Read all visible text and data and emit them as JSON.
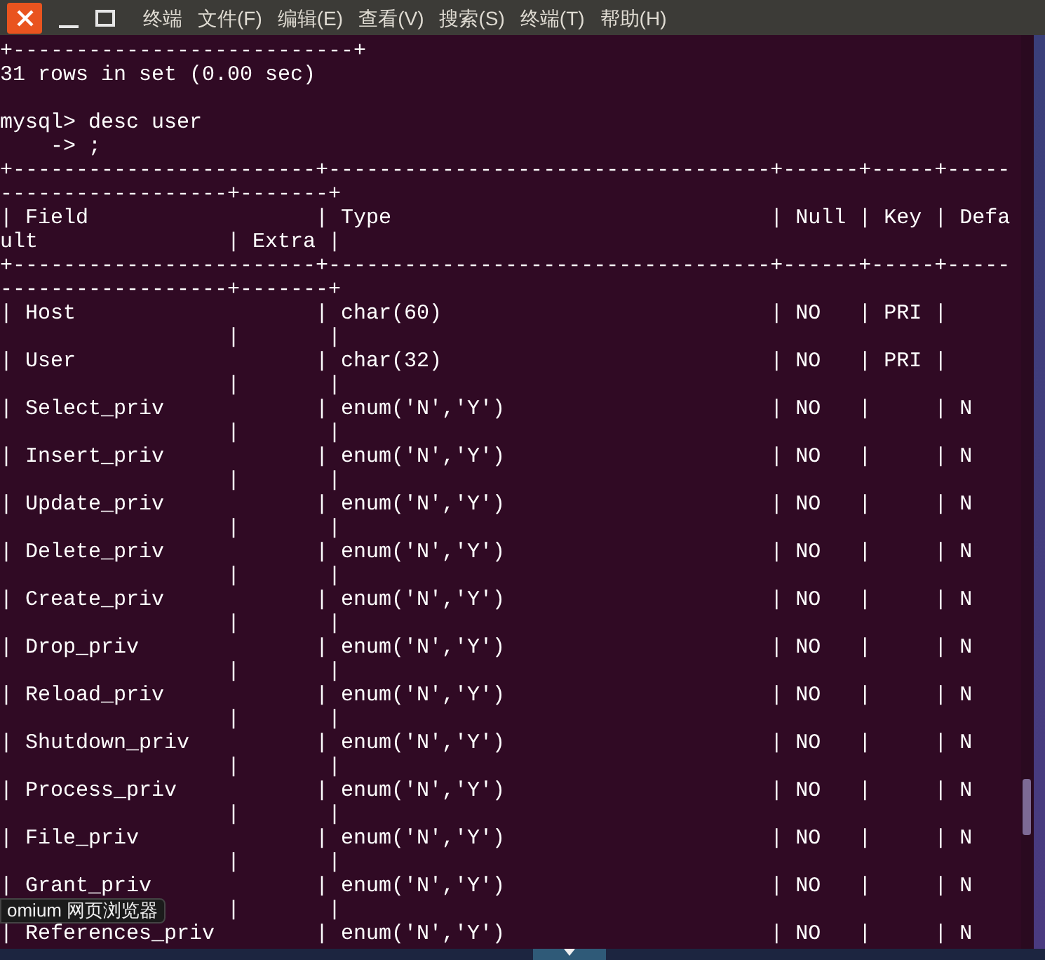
{
  "menu_bar": {
    "items": [
      "终端",
      "文件(F)",
      "编辑(E)",
      "查看(V)",
      "搜索(S)",
      "终端(T)",
      "帮助(H)"
    ]
  },
  "terminal": {
    "lines": [
      {
        "kind": "text",
        "text": "+---------------------------+"
      },
      {
        "kind": "text",
        "text": "31 rows in set (0.00 sec)"
      },
      {
        "kind": "blank"
      },
      {
        "kind": "text",
        "text": "mysql> desc user"
      },
      {
        "kind": "text",
        "text": "    -> ;"
      },
      {
        "kind": "text",
        "text": "+------------------------+-----------------------------------+------+-----+-----"
      },
      {
        "kind": "text",
        "text": "------------------+-------+"
      },
      {
        "kind": "text",
        "text": "| Field                  | Type                              | Null | Key | Defa"
      },
      {
        "kind": "text",
        "text": "ult               | Extra |"
      },
      {
        "kind": "text",
        "text": "+------------------------+-----------------------------------+------+-----+-----"
      },
      {
        "kind": "text",
        "text": "------------------+-------+"
      },
      {
        "kind": "text",
        "text": "| Host                   | char(60)                          | NO   | PRI |"
      },
      {
        "kind": "text",
        "text": "                  |       |"
      },
      {
        "kind": "text",
        "text": "| User                   | char(32)                          | NO   | PRI |"
      },
      {
        "kind": "text",
        "text": "                  |       |"
      },
      {
        "kind": "text",
        "text": "| Select_priv            | enum('N','Y')                     | NO   |     | N"
      },
      {
        "kind": "text",
        "text": "                  |       |"
      },
      {
        "kind": "text",
        "text": "| Insert_priv            | enum('N','Y')                     | NO   |     | N"
      },
      {
        "kind": "text",
        "text": "                  |       |"
      },
      {
        "kind": "text",
        "text": "| Update_priv            | enum('N','Y')                     | NO   |     | N"
      },
      {
        "kind": "text",
        "text": "                  |       |"
      },
      {
        "kind": "text",
        "text": "| Delete_priv            | enum('N','Y')                     | NO   |     | N"
      },
      {
        "kind": "text",
        "text": "                  |       |"
      },
      {
        "kind": "text",
        "text": "| Create_priv            | enum('N','Y')                     | NO   |     | N"
      },
      {
        "kind": "text",
        "text": "                  |       |"
      },
      {
        "kind": "text",
        "text": "| Drop_priv              | enum('N','Y')                     | NO   |     | N"
      },
      {
        "kind": "text",
        "text": "                  |       |"
      },
      {
        "kind": "text",
        "text": "| Reload_priv            | enum('N','Y')                     | NO   |     | N"
      },
      {
        "kind": "text",
        "text": "                  |       |"
      },
      {
        "kind": "text",
        "text": "| Shutdown_priv          | enum('N','Y')                     | NO   |     | N"
      },
      {
        "kind": "text",
        "text": "                  |       |"
      },
      {
        "kind": "text",
        "text": "| Process_priv           | enum('N','Y')                     | NO   |     | N"
      },
      {
        "kind": "text",
        "text": "                  |       |"
      },
      {
        "kind": "text",
        "text": "| File_priv              | enum('N','Y')                     | NO   |     | N"
      },
      {
        "kind": "text",
        "text": "                  |       |"
      },
      {
        "kind": "text",
        "text": "| Grant_priv             | enum('N','Y')                     | NO   |     | N"
      },
      {
        "kind": "text",
        "text": "                  |       |"
      },
      {
        "kind": "text",
        "text": "| References_priv        | enum('N','Y')                     | NO   |     | N"
      }
    ]
  },
  "tooltip": {
    "text": "omium 网页浏览器"
  }
}
